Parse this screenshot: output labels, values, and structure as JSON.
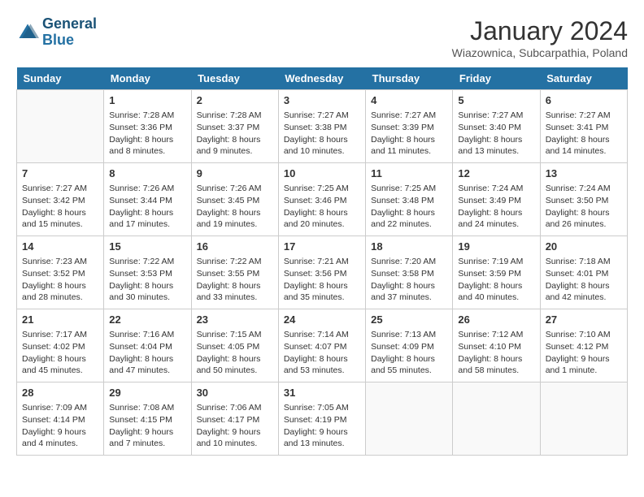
{
  "header": {
    "logo_line1": "General",
    "logo_line2": "Blue",
    "month": "January 2024",
    "location": "Wiazownica, Subcarpathia, Poland"
  },
  "weekdays": [
    "Sunday",
    "Monday",
    "Tuesday",
    "Wednesday",
    "Thursday",
    "Friday",
    "Saturday"
  ],
  "weeks": [
    [
      {
        "day": "",
        "info": ""
      },
      {
        "day": "1",
        "info": "Sunrise: 7:28 AM\nSunset: 3:36 PM\nDaylight: 8 hours\nand 8 minutes."
      },
      {
        "day": "2",
        "info": "Sunrise: 7:28 AM\nSunset: 3:37 PM\nDaylight: 8 hours\nand 9 minutes."
      },
      {
        "day": "3",
        "info": "Sunrise: 7:27 AM\nSunset: 3:38 PM\nDaylight: 8 hours\nand 10 minutes."
      },
      {
        "day": "4",
        "info": "Sunrise: 7:27 AM\nSunset: 3:39 PM\nDaylight: 8 hours\nand 11 minutes."
      },
      {
        "day": "5",
        "info": "Sunrise: 7:27 AM\nSunset: 3:40 PM\nDaylight: 8 hours\nand 13 minutes."
      },
      {
        "day": "6",
        "info": "Sunrise: 7:27 AM\nSunset: 3:41 PM\nDaylight: 8 hours\nand 14 minutes."
      }
    ],
    [
      {
        "day": "7",
        "info": "Sunrise: 7:27 AM\nSunset: 3:42 PM\nDaylight: 8 hours\nand 15 minutes."
      },
      {
        "day": "8",
        "info": "Sunrise: 7:26 AM\nSunset: 3:44 PM\nDaylight: 8 hours\nand 17 minutes."
      },
      {
        "day": "9",
        "info": "Sunrise: 7:26 AM\nSunset: 3:45 PM\nDaylight: 8 hours\nand 19 minutes."
      },
      {
        "day": "10",
        "info": "Sunrise: 7:25 AM\nSunset: 3:46 PM\nDaylight: 8 hours\nand 20 minutes."
      },
      {
        "day": "11",
        "info": "Sunrise: 7:25 AM\nSunset: 3:48 PM\nDaylight: 8 hours\nand 22 minutes."
      },
      {
        "day": "12",
        "info": "Sunrise: 7:24 AM\nSunset: 3:49 PM\nDaylight: 8 hours\nand 24 minutes."
      },
      {
        "day": "13",
        "info": "Sunrise: 7:24 AM\nSunset: 3:50 PM\nDaylight: 8 hours\nand 26 minutes."
      }
    ],
    [
      {
        "day": "14",
        "info": "Sunrise: 7:23 AM\nSunset: 3:52 PM\nDaylight: 8 hours\nand 28 minutes."
      },
      {
        "day": "15",
        "info": "Sunrise: 7:22 AM\nSunset: 3:53 PM\nDaylight: 8 hours\nand 30 minutes."
      },
      {
        "day": "16",
        "info": "Sunrise: 7:22 AM\nSunset: 3:55 PM\nDaylight: 8 hours\nand 33 minutes."
      },
      {
        "day": "17",
        "info": "Sunrise: 7:21 AM\nSunset: 3:56 PM\nDaylight: 8 hours\nand 35 minutes."
      },
      {
        "day": "18",
        "info": "Sunrise: 7:20 AM\nSunset: 3:58 PM\nDaylight: 8 hours\nand 37 minutes."
      },
      {
        "day": "19",
        "info": "Sunrise: 7:19 AM\nSunset: 3:59 PM\nDaylight: 8 hours\nand 40 minutes."
      },
      {
        "day": "20",
        "info": "Sunrise: 7:18 AM\nSunset: 4:01 PM\nDaylight: 8 hours\nand 42 minutes."
      }
    ],
    [
      {
        "day": "21",
        "info": "Sunrise: 7:17 AM\nSunset: 4:02 PM\nDaylight: 8 hours\nand 45 minutes."
      },
      {
        "day": "22",
        "info": "Sunrise: 7:16 AM\nSunset: 4:04 PM\nDaylight: 8 hours\nand 47 minutes."
      },
      {
        "day": "23",
        "info": "Sunrise: 7:15 AM\nSunset: 4:05 PM\nDaylight: 8 hours\nand 50 minutes."
      },
      {
        "day": "24",
        "info": "Sunrise: 7:14 AM\nSunset: 4:07 PM\nDaylight: 8 hours\nand 53 minutes."
      },
      {
        "day": "25",
        "info": "Sunrise: 7:13 AM\nSunset: 4:09 PM\nDaylight: 8 hours\nand 55 minutes."
      },
      {
        "day": "26",
        "info": "Sunrise: 7:12 AM\nSunset: 4:10 PM\nDaylight: 8 hours\nand 58 minutes."
      },
      {
        "day": "27",
        "info": "Sunrise: 7:10 AM\nSunset: 4:12 PM\nDaylight: 9 hours\nand 1 minute."
      }
    ],
    [
      {
        "day": "28",
        "info": "Sunrise: 7:09 AM\nSunset: 4:14 PM\nDaylight: 9 hours\nand 4 minutes."
      },
      {
        "day": "29",
        "info": "Sunrise: 7:08 AM\nSunset: 4:15 PM\nDaylight: 9 hours\nand 7 minutes."
      },
      {
        "day": "30",
        "info": "Sunrise: 7:06 AM\nSunset: 4:17 PM\nDaylight: 9 hours\nand 10 minutes."
      },
      {
        "day": "31",
        "info": "Sunrise: 7:05 AM\nSunset: 4:19 PM\nDaylight: 9 hours\nand 13 minutes."
      },
      {
        "day": "",
        "info": ""
      },
      {
        "day": "",
        "info": ""
      },
      {
        "day": "",
        "info": ""
      }
    ]
  ]
}
